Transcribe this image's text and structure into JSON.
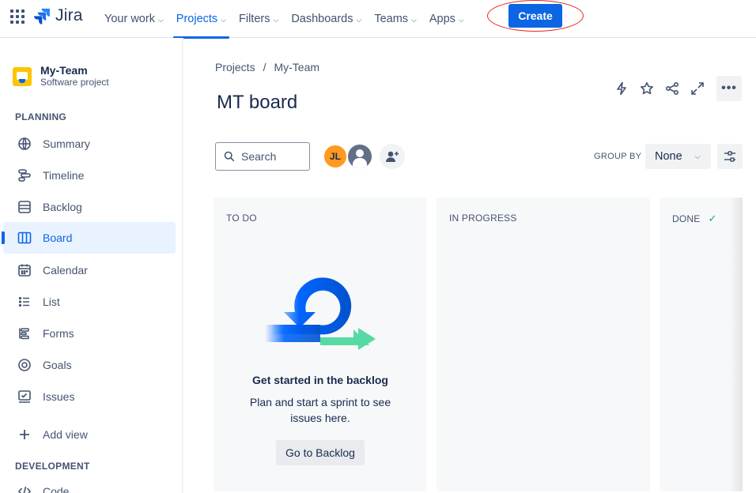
{
  "nav": {
    "logo_text": "Jira",
    "items": [
      {
        "label": "Your work"
      },
      {
        "label": "Projects"
      },
      {
        "label": "Filters"
      },
      {
        "label": "Dashboards"
      },
      {
        "label": "Teams"
      },
      {
        "label": "Apps"
      }
    ],
    "active_item": "Projects",
    "create_label": "Create"
  },
  "sidebar": {
    "project_name": "My-Team",
    "project_type": "Software project",
    "planning_heading": "PLANNING",
    "items": [
      {
        "label": "Summary",
        "icon": "globe-icon"
      },
      {
        "label": "Timeline",
        "icon": "timeline-icon"
      },
      {
        "label": "Backlog",
        "icon": "backlog-icon"
      },
      {
        "label": "Board",
        "icon": "board-icon",
        "active": true
      },
      {
        "label": "Calendar",
        "icon": "calendar-icon"
      },
      {
        "label": "List",
        "icon": "list-icon"
      },
      {
        "label": "Forms",
        "icon": "forms-icon"
      },
      {
        "label": "Goals",
        "icon": "goals-icon"
      },
      {
        "label": "Issues",
        "icon": "issues-icon"
      }
    ],
    "add_view_label": "Add view",
    "development_heading": "DEVELOPMENT",
    "dev_items": [
      {
        "label": "Code",
        "icon": "code-icon"
      }
    ]
  },
  "main": {
    "breadcrumb": [
      "Projects",
      "My-Team"
    ],
    "breadcrumb_sep": "/",
    "title": "MT board",
    "search_placeholder": "Search",
    "avatar_initials": "JL",
    "group_by_label": "GROUP BY",
    "group_by_value": "None",
    "columns": [
      {
        "title": "TO DO"
      },
      {
        "title": "IN PROGRESS"
      },
      {
        "title": "DONE",
        "icon": "check-icon"
      }
    ],
    "empty_state": {
      "title": "Get started in the backlog",
      "description": "Plan and start a sprint to see issues here.",
      "button_label": "Go to Backlog"
    }
  },
  "colors": {
    "accent": "#0c66e4",
    "annotation_ring": "#e0241b",
    "avatar_orange": "#ff991f",
    "done_check": "#22a06b"
  }
}
